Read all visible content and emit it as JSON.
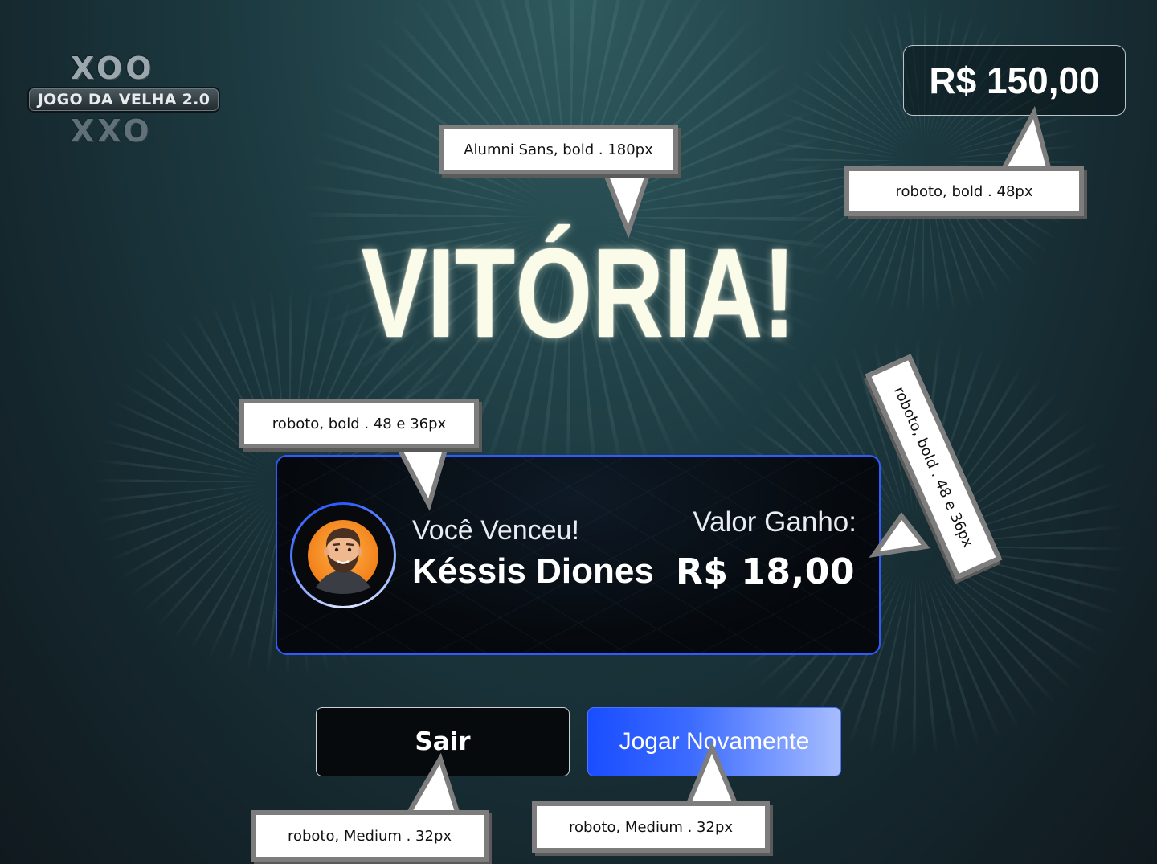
{
  "logo": {
    "top_symbols": "XOO",
    "banner_text": "JOGO DA VELHA 2.0",
    "bottom_symbols": "XXO"
  },
  "balance": "R$ 150,00",
  "title": "VITÓRIA!",
  "result": {
    "winner_label": "Você Venceu!",
    "winner_name": "Késsis Diones",
    "prize_label": "Valor Ganho:",
    "prize_value": "R$ 18,00"
  },
  "buttons": {
    "exit": "Sair",
    "play_again": "Jogar Novamente"
  },
  "annotations": {
    "title_font": "Alumni Sans, bold . 180px",
    "balance_font": "roboto, bold . 48px",
    "winner_font": "roboto, bold . 48 e 36px",
    "prize_font": "roboto, bold . 48 e 36px",
    "exit_font": "roboto, Medium . 32px",
    "again_font": "roboto, Medium . 32px"
  },
  "colors": {
    "accent_blue": "#2f5bff",
    "title": "#fbfbe9",
    "background": "#1d3b42"
  }
}
